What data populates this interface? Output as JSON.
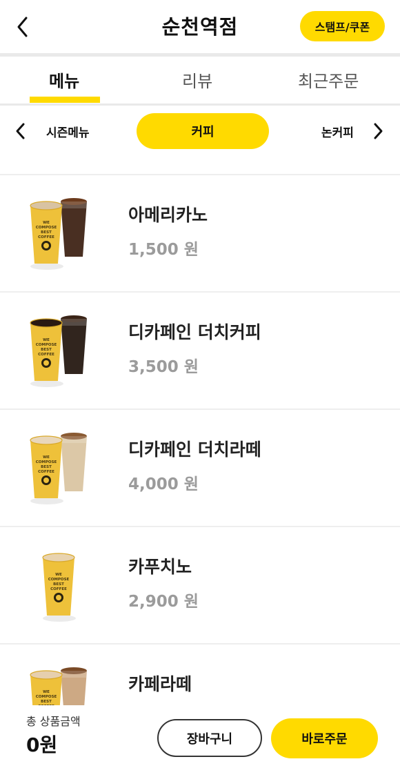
{
  "header": {
    "title": "순천역점",
    "stamp_coupon_label": "스탬프/쿠폰"
  },
  "tabs": [
    {
      "label": "메뉴",
      "active": true
    },
    {
      "label": "리뷰",
      "active": false
    },
    {
      "label": "최근주문",
      "active": false
    }
  ],
  "categories": {
    "prev_label": "시즌메뉴",
    "current_label": "커피",
    "next_label": "논커피"
  },
  "menu_items": [
    {
      "name": "아메리카노",
      "price": "1,500 원",
      "drink": "americano"
    },
    {
      "name": "디카페인 더치커피",
      "price": "3,500 원",
      "drink": "dutch"
    },
    {
      "name": "디카페인 더치라떼",
      "price": "4,000 원",
      "drink": "dutch-latte"
    },
    {
      "name": "카푸치노",
      "price": "2,900 원",
      "drink": "cappuccino"
    },
    {
      "name": "카페라떼",
      "price": "",
      "drink": "latte"
    }
  ],
  "cup_text": "WE COMPOSE BEST COFFEE",
  "footer": {
    "total_label": "총 상품금액",
    "total_value": "0원",
    "cart_label": "장바구니",
    "order_label": "바로주문"
  },
  "colors": {
    "accent": "#FFDA00",
    "cup_yellow": "#EEC13A",
    "price_gray": "#9b9b9b"
  }
}
